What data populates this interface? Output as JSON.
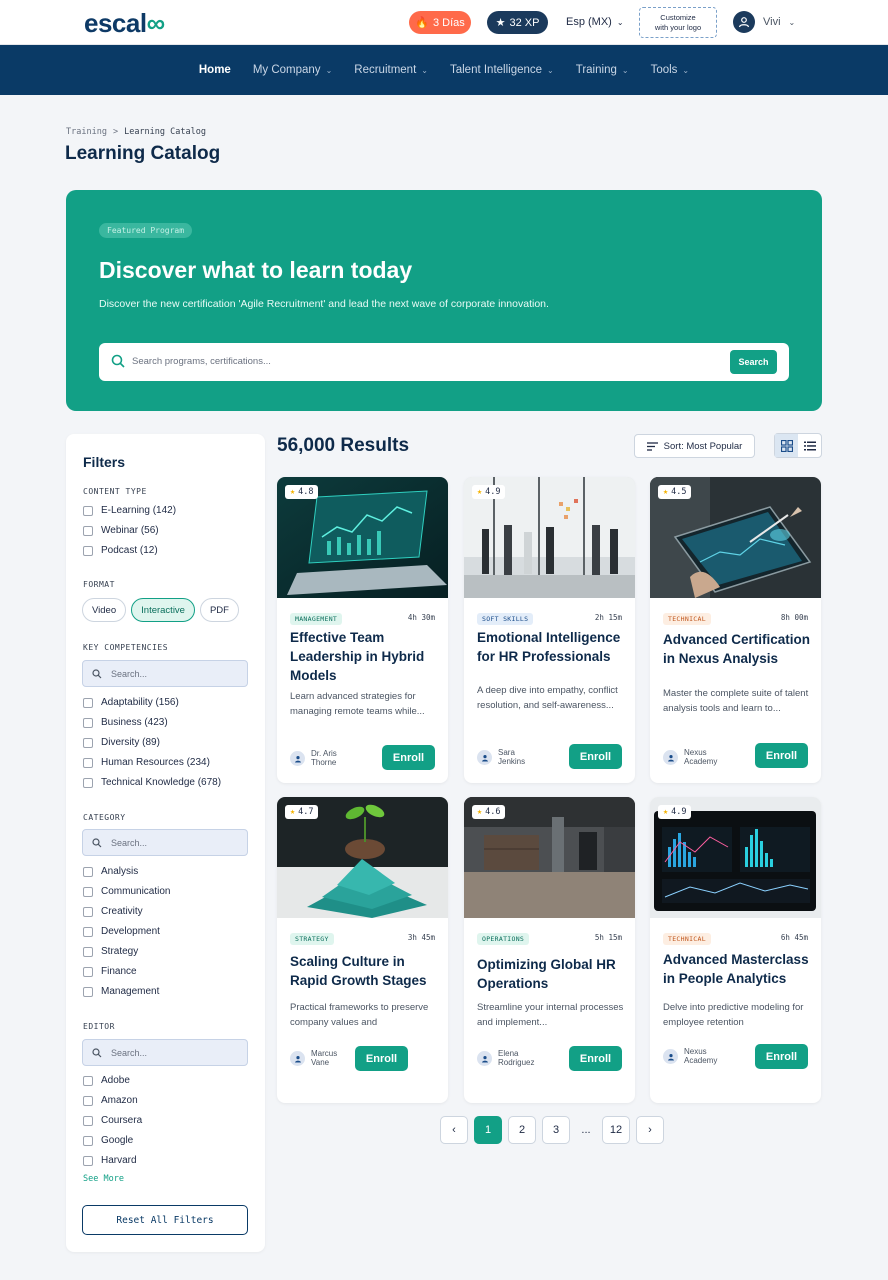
{
  "header": {
    "logo_text": "escal",
    "streak_label": "3 Días",
    "xp_label": "32 XP",
    "language": "Esp (MX)",
    "customize_label": "Customize\nwith your logo",
    "user_name": "Vivi"
  },
  "nav": {
    "items": [
      {
        "label": "Home",
        "active": true
      },
      {
        "label": "My Company"
      },
      {
        "label": "Recruitment"
      },
      {
        "label": "Talent Intelligence"
      },
      {
        "label": "Training"
      },
      {
        "label": "Tools"
      }
    ]
  },
  "breadcrumb": {
    "parent": "Training",
    "separator": ">",
    "current": "Learning Catalog"
  },
  "page_title": "Learning Catalog",
  "hero": {
    "badge": "Featured Program",
    "title": "Discover what to learn today",
    "subtitle": "Discover the new certification 'Agile Recruitment' and lead the next wave of corporate innovation.",
    "search_placeholder": "Search programs, certifications...",
    "search_button": "Search"
  },
  "filters": {
    "title": "Filters",
    "content_type": {
      "label": "CONTENT TYPE",
      "options": [
        "E-Learning (142)",
        "Webinar (56)",
        "Podcast (12)"
      ]
    },
    "format": {
      "label": "FORMAT",
      "options": [
        "Video",
        "Interactive",
        "PDF"
      ],
      "selected": "Interactive"
    },
    "competencies": {
      "label": "KEY COMPETENCIES",
      "search_placeholder": "Search...",
      "options": [
        "Adaptability (156)",
        "Business (423)",
        "Diversity (89)",
        "Human Resources (234)",
        "Technical Knowledge (678)"
      ]
    },
    "category": {
      "label": "CATEGORY",
      "search_placeholder": "Search...",
      "options": [
        "Analysis",
        "Communication",
        "Creativity",
        "Development",
        "Strategy",
        "Finance",
        "Management"
      ]
    },
    "editor": {
      "label": "EDITOR",
      "search_placeholder": "Search...",
      "options": [
        "Adobe",
        "Amazon",
        "Coursera",
        "Google",
        "Harvard"
      ]
    },
    "see_more": "See More",
    "reset": "Reset All Filters"
  },
  "results": {
    "count_label": "56,000 Results",
    "sort_label": "Sort: Most Popular"
  },
  "courses": [
    {
      "rating": "4.8",
      "tag": "MANAGEMENT",
      "tag_color": "green",
      "duration": "4h 30m",
      "title": "Effective Team Leadership in Hybrid Models",
      "desc": "Learn advanced strategies for managing remote teams while...",
      "author": "Dr. Aris\nThorne",
      "enroll": "Enroll",
      "image": "laptop-analytics"
    },
    {
      "rating": "4.9",
      "tag": "SOFT SKILLS",
      "tag_color": "blue",
      "duration": "2h 15m",
      "title": "Emotional Intelligence for HR Professionals",
      "desc": "A deep dive into empathy, conflict resolution, and self-awareness...",
      "author": "Sara\nJenkins",
      "enroll": "Enroll",
      "image": "office-team"
    },
    {
      "rating": "4.5",
      "tag": "TECHNICAL",
      "tag_color": "orange",
      "duration": "8h 00m",
      "title": "Advanced Certification in Nexus Analysis",
      "desc": "Master the complete suite of talent analysis tools and learn to...",
      "author": "Nexus\nAcademy",
      "enroll": "Enroll",
      "image": "tablet-stylus"
    },
    {
      "rating": "4.7",
      "tag": "STRATEGY",
      "tag_color": "green",
      "duration": "3h 45m",
      "title": "Scaling Culture in Rapid Growth Stages",
      "desc": "Practical frameworks to preserve company values and",
      "author": "Marcus\nVane",
      "enroll": "Enroll",
      "image": "plant-growth"
    },
    {
      "rating": "4.6",
      "tag": "OPERATIONS",
      "tag_color": "green",
      "duration": "5h 15m",
      "title": "Optimizing Global HR Operations",
      "desc": "Streamline your internal processes and implement...",
      "author": "Elena\nRodriguez",
      "enroll": "Enroll",
      "image": "office-hallway"
    },
    {
      "rating": "4.9",
      "tag": "TECHNICAL",
      "tag_color": "orange",
      "duration": "6h 45m",
      "title": "Advanced Masterclass in People Analytics",
      "desc": "Delve into predictive modeling for employee retention",
      "author": "Nexus\nAcademy",
      "enroll": "Enroll",
      "image": "dashboard-screen"
    }
  ],
  "pagination": {
    "pages": [
      "1",
      "2",
      "3",
      "...",
      "12"
    ],
    "current": "1"
  },
  "colors": {
    "brand_teal": "#12a086",
    "navy": "#0a3a66",
    "streak_orange": "#ff6a4a"
  }
}
